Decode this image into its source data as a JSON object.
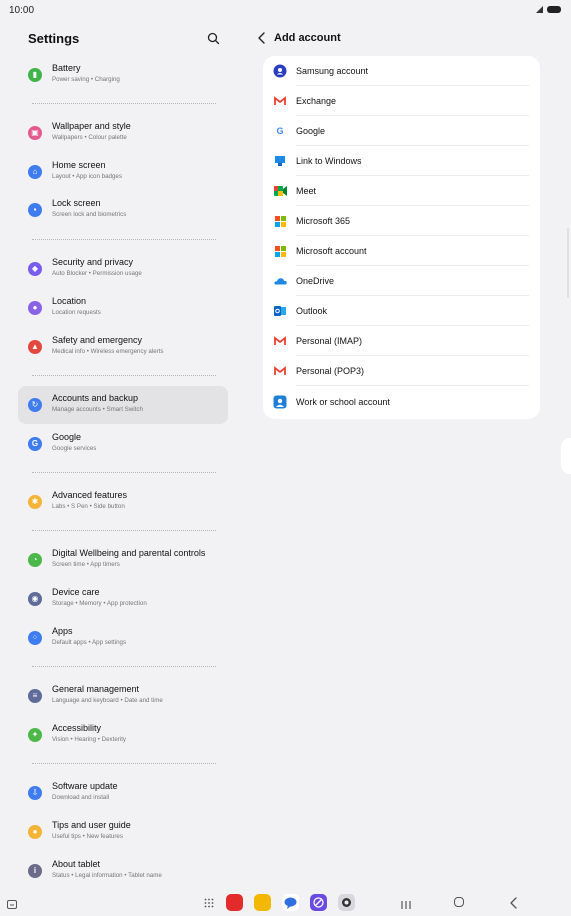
{
  "status_bar": {
    "time": "10:00"
  },
  "left_panel": {
    "title": "Settings",
    "search_icon": "search-icon",
    "items": [
      {
        "id": "battery",
        "title": "Battery",
        "subtitle": "Power saving • Charging",
        "icon": "battery-icon",
        "color": "#3db54a"
      },
      {
        "id": "wallpaper",
        "title": "Wallpaper and style",
        "subtitle": "Wallpapers • Colour palette",
        "icon": "wallpaper-icon",
        "color": "#e45b8b"
      },
      {
        "id": "home-screen",
        "title": "Home screen",
        "subtitle": "Layout • App icon badges",
        "icon": "home-icon",
        "color": "#3f7cf0"
      },
      {
        "id": "lock-screen",
        "title": "Lock screen",
        "subtitle": "Screen lock and biometrics",
        "icon": "lock-icon",
        "color": "#3f7cf0"
      },
      {
        "id": "security",
        "title": "Security and privacy",
        "subtitle": "Auto Blocker • Permission usage",
        "icon": "shield-icon",
        "color": "#7a5cf0"
      },
      {
        "id": "location",
        "title": "Location",
        "subtitle": "Location requests",
        "icon": "location-icon",
        "color": "#8a62e6"
      },
      {
        "id": "safety",
        "title": "Safety and emergency",
        "subtitle": "Medical info • Wireless emergency alerts",
        "icon": "emergency-icon",
        "color": "#e2483d"
      },
      {
        "id": "accounts",
        "title": "Accounts and backup",
        "subtitle": "Manage accounts • Smart Switch",
        "icon": "sync-icon",
        "color": "#3f7cf0"
      },
      {
        "id": "google",
        "title": "Google",
        "subtitle": "Google services",
        "icon": "google-icon",
        "color": "#3f7cf0"
      },
      {
        "id": "advanced",
        "title": "Advanced features",
        "subtitle": "Labs • S Pen • Side button",
        "icon": "gear-plus-icon",
        "color": "#f3b437"
      },
      {
        "id": "wellbeing",
        "title": "Digital Wellbeing and parental controls",
        "subtitle": "Screen time • App timers",
        "icon": "wellbeing-icon",
        "color": "#4cb848"
      },
      {
        "id": "device-care",
        "title": "Device care",
        "subtitle": "Storage • Memory • App protection",
        "icon": "device-care-icon",
        "color": "#5f6b98"
      },
      {
        "id": "apps",
        "title": "Apps",
        "subtitle": "Default apps • App settings",
        "icon": "apps-icon",
        "color": "#3f7cf0"
      },
      {
        "id": "general",
        "title": "General management",
        "subtitle": "Language and keyboard • Date and time",
        "icon": "sliders-icon",
        "color": "#5f6b98"
      },
      {
        "id": "accessibility",
        "title": "Accessibility",
        "subtitle": "Vision • Hearing • Dexterity",
        "icon": "accessibility-icon",
        "color": "#4cb848"
      },
      {
        "id": "software",
        "title": "Software update",
        "subtitle": "Download and install",
        "icon": "update-icon",
        "color": "#3f7cf0"
      },
      {
        "id": "tips",
        "title": "Tips and user guide",
        "subtitle": "Useful tips • New features",
        "icon": "lightbulb-icon",
        "color": "#f3b437"
      },
      {
        "id": "about",
        "title": "About tablet",
        "subtitle": "Status • Legal information • Tablet name",
        "icon": "info-icon",
        "color": "#6b6b8a"
      }
    ]
  },
  "right_panel": {
    "title": "Add account",
    "back_icon": "chevron-left-icon",
    "accounts": [
      {
        "label": "Samsung account",
        "icon": "samsung-account-icon"
      },
      {
        "label": "Exchange",
        "icon": "gmail-icon"
      },
      {
        "label": "Google",
        "icon": "google-icon"
      },
      {
        "label": "Link to Windows",
        "icon": "link-to-windows-icon"
      },
      {
        "label": "Meet",
        "icon": "meet-icon"
      },
      {
        "label": "Microsoft 365",
        "icon": "microsoft-icon"
      },
      {
        "label": "Microsoft account",
        "icon": "microsoft-icon"
      },
      {
        "label": "OneDrive",
        "icon": "onedrive-icon"
      },
      {
        "label": "Outlook",
        "icon": "outlook-icon"
      },
      {
        "label": "Personal (IMAP)",
        "icon": "gmail-icon"
      },
      {
        "label": "Personal (POP3)",
        "icon": "gmail-icon"
      },
      {
        "label": "Work or school account",
        "icon": "work-account-icon"
      }
    ]
  },
  "nav_bar": {
    "dock_apps": [
      {
        "name": "flipboard-app-icon",
        "color": "#e32b2b"
      },
      {
        "name": "my-files-app-icon",
        "color": "#f5b800"
      },
      {
        "name": "messages-app-icon",
        "color": "#2f6fe0"
      },
      {
        "name": "internet-app-icon",
        "color": "#6a4ae0"
      },
      {
        "name": "camera-app-icon",
        "color": "#d8d8dc"
      }
    ]
  }
}
